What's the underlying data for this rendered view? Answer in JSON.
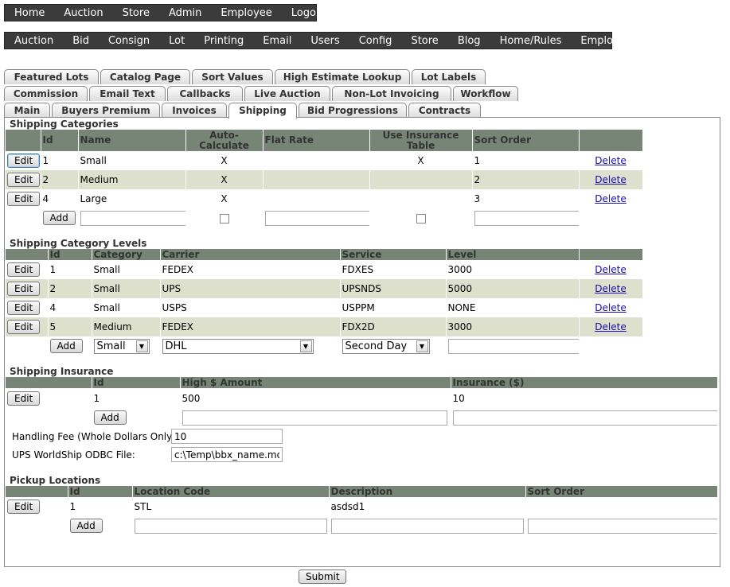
{
  "nav_top": [
    "Home",
    "Auction",
    "Store",
    "Admin",
    "Employee",
    "Logout"
  ],
  "nav_admin": [
    "Auction",
    "Bid",
    "Consign",
    "Lot",
    "Printing",
    "Email",
    "Users",
    "Config",
    "Store",
    "Blog",
    "Home/Rules",
    "Employees"
  ],
  "tabs_row1": [
    "Featured Lots",
    "Catalog Page",
    "Sort Values",
    "High Estimate Lookup",
    "Lot Labels"
  ],
  "tabs_row2": [
    "Commission",
    "Email Text",
    "Callbacks",
    "Live Auction",
    "Non-Lot Invoicing",
    "Workflow"
  ],
  "tabs_row3": [
    "Main",
    "Buyers Premium",
    "Invoices",
    "Shipping",
    "Bid Progressions",
    "Contracts"
  ],
  "active_tab": "Shipping",
  "buttons": {
    "edit": "Edit",
    "add": "Add",
    "delete": "Delete",
    "submit": "Submit"
  },
  "categories": {
    "title": "Shipping Categories",
    "headers": [
      "Id",
      "Name",
      "Auto-Calculate",
      "Flat Rate",
      "Use Insurance Table",
      "Sort Order"
    ],
    "rows": [
      {
        "id": "1",
        "name": "Small",
        "auto": "X",
        "flat": "",
        "ins": "X",
        "sort": "1"
      },
      {
        "id": "2",
        "name": "Medium",
        "auto": "X",
        "flat": "",
        "ins": "",
        "sort": "2"
      },
      {
        "id": "4",
        "name": "Large",
        "auto": "X",
        "flat": "",
        "ins": "",
        "sort": "3"
      }
    ]
  },
  "levels": {
    "title": "Shipping Category Levels",
    "headers": [
      "Id",
      "Category",
      "Carrier",
      "Service",
      "Level"
    ],
    "rows": [
      {
        "id": "1",
        "category": "Small",
        "carrier": "FEDEX",
        "service": "FDXES",
        "level": "3000"
      },
      {
        "id": "2",
        "category": "Small",
        "carrier": "UPS",
        "service": "UPSNDS",
        "level": "5000"
      },
      {
        "id": "4",
        "category": "Small",
        "carrier": "USPS",
        "service": "USPPM",
        "level": "NONE"
      },
      {
        "id": "5",
        "category": "Medium",
        "carrier": "FEDEX",
        "service": "FDX2D",
        "level": "3000"
      }
    ],
    "new_category": "Small",
    "new_carrier": "DHL",
    "new_service": "Second Day"
  },
  "insurance": {
    "title": "Shipping Insurance",
    "headers": [
      "Id",
      "High $ Amount",
      "Insurance ($)"
    ],
    "rows": [
      {
        "id": "1",
        "high": "500",
        "ins": "10"
      }
    ]
  },
  "handling_fee": {
    "label": "Handling Fee (Whole Dollars Only):",
    "value": "10"
  },
  "ups_file": {
    "label": "UPS WorldShip ODBC File:",
    "value": "c:\\Temp\\bbx_name.md"
  },
  "pickup": {
    "title": "Pickup Locations",
    "headers": [
      "Id",
      "Location Code",
      "Description",
      "Sort Order"
    ],
    "rows": [
      {
        "id": "1",
        "code": "STL",
        "desc": "asdsd1",
        "sort": ""
      }
    ]
  }
}
